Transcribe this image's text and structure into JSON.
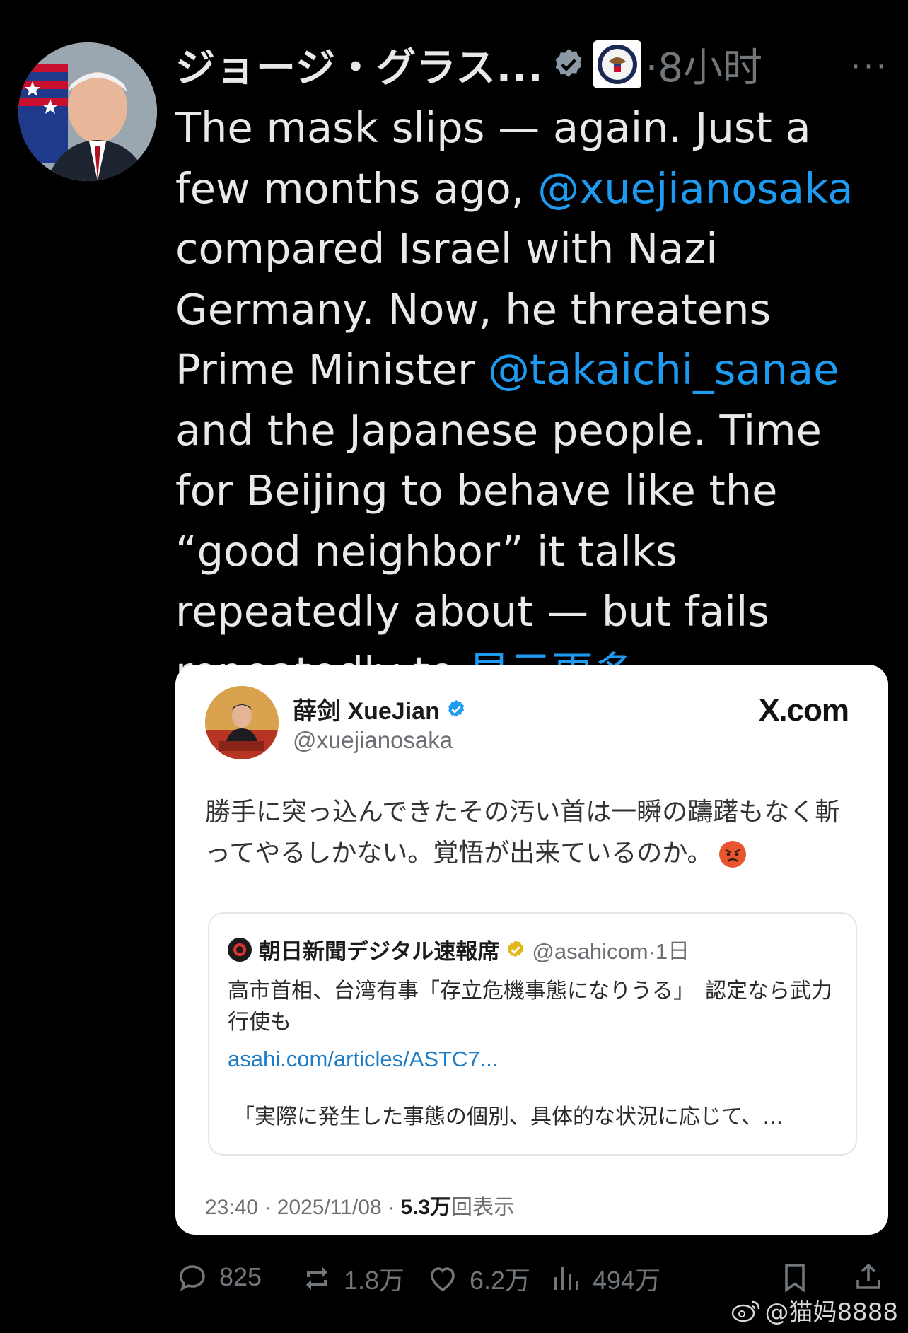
{
  "tweet": {
    "author_name": "ジョージ・グラス...",
    "time_label": "·8小时",
    "more_label": "···",
    "text": {
      "part1": "The mask slips — again. Just a few months ago, ",
      "mention1": "@xuejianosaka",
      "part2": " compared Israel with Nazi Germany. Now, he threatens Prime Minister ",
      "mention2": "@takaichi_sanae",
      "part3": " and the Japanese people. Time for Beijing to behave like the “good neighbor” it talks repeatedly about — but fails repeatedly to ",
      "show_more": "显示更多"
    }
  },
  "embedded_card": {
    "name": "薛剑 XueJian",
    "handle": "@xuejianosaka",
    "site_logo": "X.com",
    "body": "勝手に突っ込んできたその汚い首は一瞬の躊躇もなく斬ってやるしかない。覚悟が出来ているのか。",
    "quote": {
      "name": "朝日新聞デジタル速報席",
      "meta": "@asahicom·1日",
      "body": "高市首相、台湾有事「存立危機事態になりうる」　認定なら武力行使も",
      "link": "asahi.com/articles/ASTC7...",
      "excerpt": "「実際に発生した事態の個別、具体的な状況に応じて、..."
    },
    "footer": {
      "time": "23:40 · 2025/11/08 · ",
      "views_count": "5.3万",
      "views_label": "回表示"
    }
  },
  "actions": {
    "replies": "825",
    "retweets": "1.8万",
    "likes": "6.2万",
    "views": "494万"
  },
  "watermark": "@猫妈8888",
  "colors": {
    "background": "#000000",
    "text": "#e7e9ea",
    "link": "#1d9bf0",
    "muted": "#71767b",
    "verified_blue": "#1d9bf0",
    "card_bg": "#ffffff"
  }
}
